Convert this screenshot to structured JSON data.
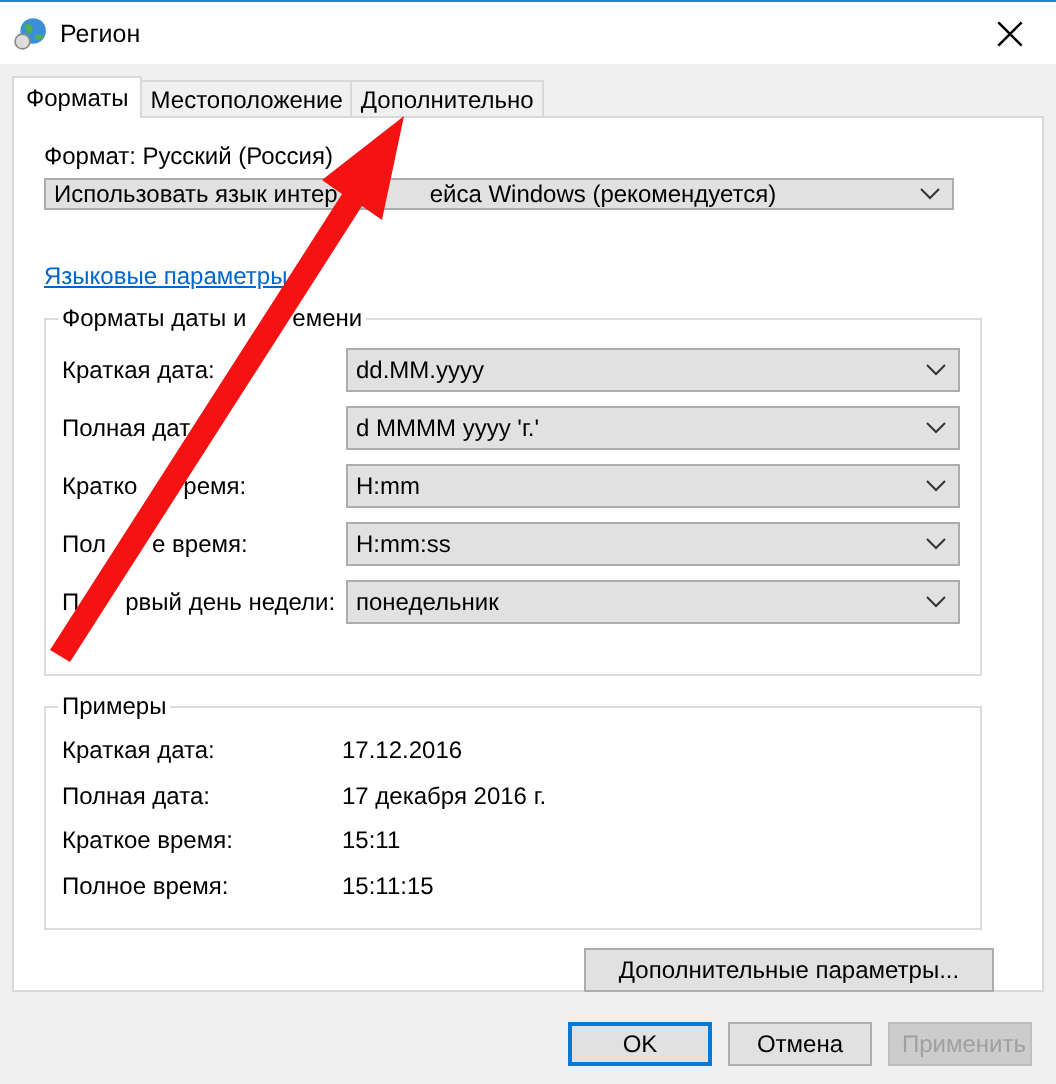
{
  "window": {
    "title": "Регион"
  },
  "tabs": [
    {
      "label": "Форматы",
      "selected": true
    },
    {
      "label": "Местоположение",
      "selected": false
    },
    {
      "label": "Дополнительно",
      "selected": false
    }
  ],
  "format": {
    "label": "Формат: Русский (Россия)",
    "value_parts": [
      "Использовать язык интер",
      "ейса Windows (рекомендуется)"
    ]
  },
  "link": "Языковые параметры",
  "formats_group": {
    "title_parts": [
      "Форматы даты и",
      "емени"
    ],
    "rows": [
      {
        "label_parts": [
          "Краткая дата:"
        ],
        "value": "dd.MM.yyyy"
      },
      {
        "label_parts": [
          "Полная дат"
        ],
        "value": "d MMMM yyyy 'г.'"
      },
      {
        "label_parts": [
          "Кратко",
          "ремя:"
        ],
        "value": "H:mm"
      },
      {
        "label_parts": [
          "Пол",
          "е время:"
        ],
        "value": "H:mm:ss"
      },
      {
        "label_parts": [
          "П",
          "рвый день недели:"
        ],
        "value": "понедельник"
      }
    ]
  },
  "examples_group": {
    "title": "Примеры",
    "rows": [
      {
        "label": "Краткая дата:",
        "value": "17.12.2016"
      },
      {
        "label": "Полная дата:",
        "value": "17 декабря 2016 г."
      },
      {
        "label": "Краткое время:",
        "value": "15:11"
      },
      {
        "label": "Полное время:",
        "value": "15:11:15"
      }
    ]
  },
  "advanced_button": "Дополнительные параметры...",
  "buttons": [
    {
      "label": "OK",
      "default": true,
      "disabled": false
    },
    {
      "label": "Отмена",
      "default": false,
      "disabled": false
    },
    {
      "label": "Применить",
      "default": false,
      "disabled": true
    }
  ]
}
